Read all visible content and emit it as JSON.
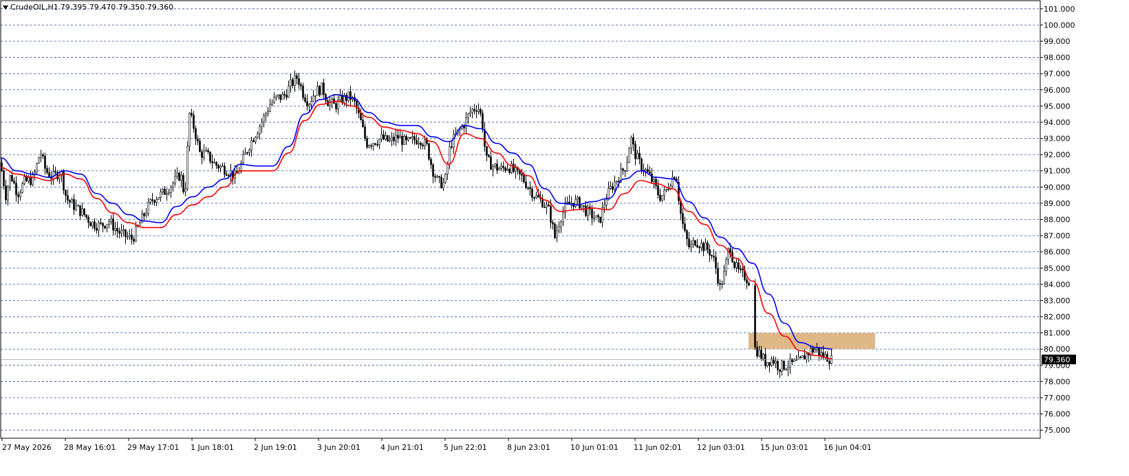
{
  "header": {
    "symbol": "CrudeOIL,H1",
    "ohlc": "79.395 79.470 79.350 79.360"
  },
  "chart_data": {
    "type": "candlestick",
    "price_axis": {
      "min": 74.5,
      "max": 101.5,
      "ticks": [
        "101.000",
        "100.000",
        "99.000",
        "98.000",
        "97.000",
        "96.000",
        "95.000",
        "94.000",
        "93.000",
        "92.000",
        "91.000",
        "90.000",
        "89.000",
        "88.000",
        "87.000",
        "86.000",
        "85.000",
        "84.000",
        "83.000",
        "82.000",
        "81.000",
        "80.000",
        "79.000",
        "78.000",
        "77.000",
        "76.000",
        "75.000"
      ],
      "grid": true,
      "current_price": "79.360"
    },
    "time_axis": {
      "labels": [
        "27 May 2026",
        "28 May 16:01",
        "29 May 17:01",
        "1 Jun 18:01",
        "2 Jun 19:01",
        "3 Jun 20:01",
        "4 Jun 21:01",
        "5 Jun 22:01",
        "8 Jun 23:01",
        "10 Jun 01:01",
        "11 Jun 02:01",
        "12 Jun 03:01",
        "15 Jun 03:01",
        "16 Jun 04:01"
      ]
    },
    "price_path": [
      [
        0,
        91.5
      ],
      [
        8,
        89.5
      ],
      [
        15,
        90.8
      ],
      [
        25,
        89.6
      ],
      [
        35,
        90.3
      ],
      [
        48,
        90.5
      ],
      [
        58,
        92.2
      ],
      [
        66,
        91.0
      ],
      [
        76,
        90.6
      ],
      [
        88,
        91.0
      ],
      [
        96,
        89.3
      ],
      [
        108,
        88.8
      ],
      [
        120,
        88.4
      ],
      [
        132,
        87.8
      ],
      [
        145,
        87.6
      ],
      [
        158,
        87.9
      ],
      [
        170,
        87.3
      ],
      [
        180,
        87.0
      ],
      [
        192,
        86.8
      ],
      [
        200,
        87.5
      ],
      [
        210,
        88.4
      ],
      [
        222,
        89.3
      ],
      [
        236,
        89.6
      ],
      [
        250,
        90.2
      ],
      [
        262,
        90.8
      ],
      [
        268,
        89.4
      ],
      [
        275,
        94.5
      ],
      [
        282,
        93.6
      ],
      [
        290,
        92.1
      ],
      [
        300,
        92.0
      ],
      [
        312,
        91.4
      ],
      [
        322,
        91.2
      ],
      [
        332,
        91.0
      ],
      [
        342,
        90.6
      ],
      [
        352,
        91.6
      ],
      [
        362,
        92.6
      ],
      [
        372,
        93.4
      ],
      [
        382,
        94.2
      ],
      [
        392,
        95.1
      ],
      [
        402,
        95.5
      ],
      [
        412,
        95.6
      ],
      [
        422,
        96.3
      ],
      [
        432,
        96.8
      ],
      [
        440,
        95.8
      ],
      [
        448,
        95.2
      ],
      [
        458,
        95.9
      ],
      [
        468,
        96.1
      ],
      [
        476,
        95.3
      ],
      [
        486,
        95.0
      ],
      [
        496,
        95.4
      ],
      [
        508,
        95.6
      ],
      [
        516,
        95.1
      ],
      [
        524,
        94.0
      ],
      [
        532,
        92.7
      ],
      [
        542,
        92.8
      ],
      [
        554,
        93.0
      ],
      [
        566,
        92.8
      ],
      [
        578,
        93.1
      ],
      [
        590,
        92.7
      ],
      [
        600,
        92.9
      ],
      [
        610,
        93.0
      ],
      [
        620,
        92.5
      ],
      [
        628,
        91.1
      ],
      [
        636,
        90.3
      ],
      [
        646,
        90.2
      ],
      [
        654,
        92.6
      ],
      [
        664,
        93.3
      ],
      [
        674,
        93.9
      ],
      [
        684,
        94.7
      ],
      [
        694,
        95.0
      ],
      [
        700,
        94.2
      ],
      [
        706,
        91.7
      ],
      [
        716,
        91.3
      ],
      [
        728,
        91.1
      ],
      [
        738,
        91.3
      ],
      [
        748,
        90.9
      ],
      [
        758,
        90.6
      ],
      [
        768,
        90.0
      ],
      [
        778,
        89.4
      ],
      [
        788,
        89.1
      ],
      [
        798,
        88.5
      ],
      [
        806,
        86.9
      ],
      [
        814,
        88.1
      ],
      [
        822,
        88.8
      ],
      [
        832,
        89.1
      ],
      [
        842,
        89.0
      ],
      [
        852,
        88.5
      ],
      [
        862,
        88.2
      ],
      [
        870,
        87.8
      ],
      [
        880,
        89.3
      ],
      [
        890,
        90.1
      ],
      [
        900,
        90.7
      ],
      [
        910,
        91.4
      ],
      [
        916,
        93.1
      ],
      [
        922,
        92.1
      ],
      [
        930,
        91.4
      ],
      [
        940,
        90.9
      ],
      [
        950,
        90.2
      ],
      [
        958,
        89.4
      ],
      [
        966,
        89.6
      ],
      [
        974,
        90.4
      ],
      [
        982,
        90.9
      ],
      [
        988,
        88.6
      ],
      [
        994,
        87.2
      ],
      [
        1002,
        86.2
      ],
      [
        1010,
        86.7
      ],
      [
        1020,
        86.4
      ],
      [
        1030,
        86.1
      ],
      [
        1038,
        85.4
      ],
      [
        1046,
        83.8
      ],
      [
        1052,
        84.6
      ],
      [
        1060,
        86.5
      ],
      [
        1066,
        85.3
      ],
      [
        1074,
        84.7
      ],
      [
        1082,
        84.5
      ],
      [
        1088,
        84.2
      ],
      [
        1096,
        80.1
      ],
      [
        1104,
        79.7
      ],
      [
        1112,
        79.2
      ],
      [
        1122,
        79.4
      ],
      [
        1132,
        78.9
      ],
      [
        1142,
        79.0
      ],
      [
        1152,
        79.1
      ],
      [
        1162,
        79.2
      ],
      [
        1170,
        79.6
      ],
      [
        1178,
        79.9
      ],
      [
        1186,
        80.0
      ],
      [
        1194,
        79.6
      ],
      [
        1202,
        79.5
      ],
      [
        1208,
        79.36
      ]
    ],
    "series": [
      {
        "type": "moving-average",
        "color": "#0000ff",
        "values": [
          91.8,
          91.0,
          90.8,
          90.6,
          91.0,
          90.8,
          89.6,
          89.0,
          88.3,
          87.9,
          87.8,
          88.8,
          89.4,
          90.0,
          90.5,
          91.4,
          91.3,
          91.3,
          92.5,
          94.5,
          95.4,
          95.7,
          95.5,
          94.6,
          94.0,
          93.8,
          93.8,
          93.1,
          92.8,
          93.8,
          93.6,
          92.7,
          92.1,
          91.4,
          89.9,
          89.0,
          88.9,
          89.1,
          89.3,
          90.5,
          91.0,
          90.6,
          90.5,
          89.1,
          88.1,
          86.9,
          86.2,
          85.3,
          83.4,
          81.6,
          80.4,
          80.1,
          80.0
        ]
      },
      {
        "type": "moving-average",
        "color": "#ff0000",
        "values": [
          91.2,
          90.8,
          90.6,
          90.4,
          90.8,
          90.5,
          89.3,
          88.4,
          87.8,
          87.5,
          87.5,
          88.3,
          88.9,
          89.4,
          90.0,
          91.0,
          91.0,
          91.0,
          92.1,
          94.1,
          95.1,
          95.3,
          95.0,
          94.3,
          93.7,
          93.5,
          93.3,
          92.8,
          91.4,
          93.3,
          93.0,
          92.1,
          91.3,
          90.7,
          89.2,
          88.5,
          88.6,
          88.7,
          88.6,
          89.6,
          90.4,
          90.2,
          89.9,
          88.5,
          87.7,
          86.4,
          85.6,
          84.2,
          82.2,
          80.8,
          79.9,
          79.6,
          79.4
        ]
      }
    ],
    "highlight_zone": {
      "color": "#deb887",
      "from": 80.0,
      "to": 81.0
    }
  }
}
